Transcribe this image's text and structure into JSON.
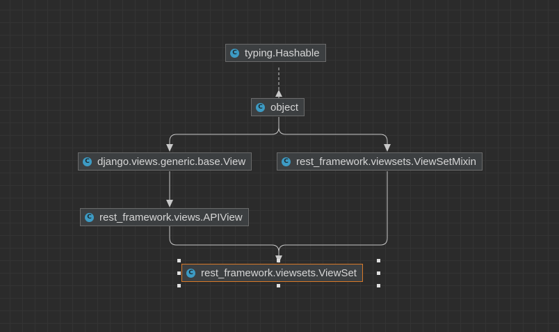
{
  "diagram": {
    "nodes": [
      {
        "id": "hashable",
        "label": "typing.Hashable",
        "icon": "class-icon",
        "icon_letter": "C"
      },
      {
        "id": "object",
        "label": "object",
        "icon": "class-icon",
        "icon_letter": "C"
      },
      {
        "id": "django_view",
        "label": "django.views.generic.base.View",
        "icon": "class-icon",
        "icon_letter": "C"
      },
      {
        "id": "viewset_mixin",
        "label": "rest_framework.viewsets.ViewSetMixin",
        "icon": "class-icon",
        "icon_letter": "C"
      },
      {
        "id": "apiview",
        "label": "rest_framework.views.APIView",
        "icon": "class-icon",
        "icon_letter": "C"
      },
      {
        "id": "viewset",
        "label": "rest_framework.viewsets.ViewSet",
        "icon": "class-icon",
        "icon_letter": "C",
        "selected": true
      }
    ],
    "edges": [
      {
        "from": "object",
        "to": "hashable",
        "style": "dashed"
      },
      {
        "from": "django_view",
        "to": "object",
        "style": "solid"
      },
      {
        "from": "viewset_mixin",
        "to": "object",
        "style": "solid"
      },
      {
        "from": "apiview",
        "to": "django_view",
        "style": "solid"
      },
      {
        "from": "viewset",
        "to": "apiview",
        "style": "solid"
      },
      {
        "from": "viewset",
        "to": "viewset_mixin",
        "style": "solid"
      }
    ],
    "colors": {
      "background": "#2b2b2b",
      "node_fill": "#3c3f41",
      "node_border": "#6b6b6b",
      "selected_border": "#d97a29",
      "edge": "#c8c8c8",
      "class_icon": "#3d9bc4"
    }
  }
}
